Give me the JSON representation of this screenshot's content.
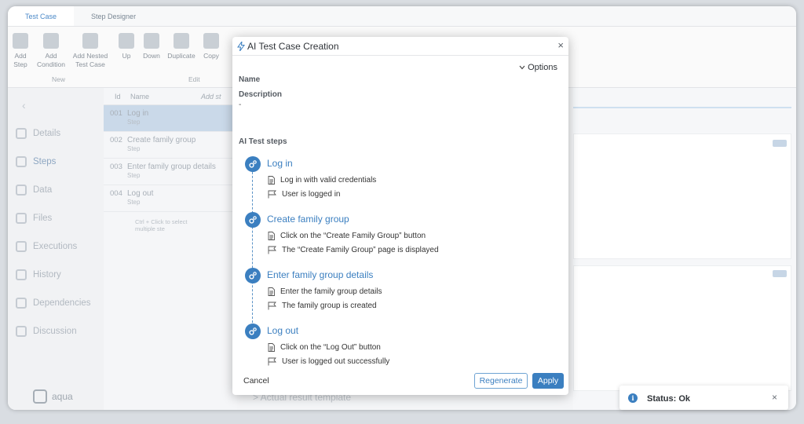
{
  "app": {
    "tabs": [
      "Test Case",
      "Step Designer"
    ],
    "toolbar": {
      "buttons": [
        {
          "label": "Add Step",
          "icon": "add-step-icon"
        },
        {
          "label": "Add Condition",
          "icon": "add-condition-icon"
        },
        {
          "label": "Add Nested Test Case",
          "icon": "add-nested-icon"
        },
        {
          "label": "Up",
          "icon": "arrow-up-icon"
        },
        {
          "label": "Down",
          "icon": "arrow-down-icon"
        },
        {
          "label": "Duplicate",
          "icon": "duplicate-icon"
        },
        {
          "label": "Copy",
          "icon": "copy-icon"
        }
      ],
      "groups": [
        "New",
        "Edit"
      ]
    },
    "sidebar": {
      "items": [
        "Details",
        "Steps",
        "Data",
        "Files",
        "Executions",
        "History",
        "Dependencies",
        "Discussion"
      ],
      "active": "Steps",
      "logo": "aqua"
    },
    "steps_list": {
      "headers": {
        "id": "Id",
        "name": "Name",
        "add": "Add st"
      },
      "rows": [
        {
          "id": "001",
          "name": "Log in",
          "type": "Step"
        },
        {
          "id": "002",
          "name": "Create family group",
          "type": "Step"
        },
        {
          "id": "003",
          "name": "Enter family group details",
          "type": "Step"
        },
        {
          "id": "004",
          "name": "Log out",
          "type": "Step"
        }
      ],
      "hint": "Ctrl + Click to select multiple ste"
    },
    "bottom_hint": "> Actual result template"
  },
  "modal": {
    "title": "AI Test Case Creation",
    "options_label": "Options",
    "name_label": "Name",
    "description_label": "Description",
    "description_value": "-",
    "steps_heading": "AI Test steps",
    "steps": [
      {
        "name": "Log in",
        "action": "Log in with valid credentials",
        "expected": "User is logged in"
      },
      {
        "name": "Create family group",
        "action": "Click on the “Create Family Group” button",
        "expected": "The “Create Family Group” page is displayed"
      },
      {
        "name": "Enter family group details",
        "action": "Enter the family group details",
        "expected": "The family group is created"
      },
      {
        "name": "Log out",
        "action": "Click on the “Log Out” button",
        "expected": "User is logged out successfully"
      }
    ],
    "cancel_label": "Cancel",
    "regenerate_label": "Regenerate",
    "apply_label": "Apply"
  },
  "toast": {
    "text": "Status: Ok"
  },
  "colors": {
    "accent": "#3b7fc0",
    "selected_row": "#cad9e9"
  }
}
